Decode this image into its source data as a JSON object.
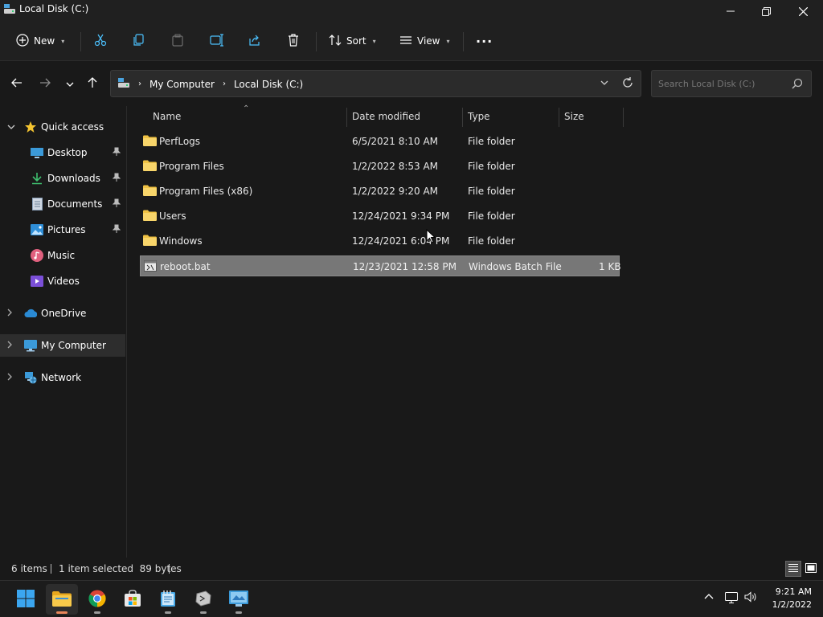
{
  "window": {
    "title": "Local Disk (C:)"
  },
  "toolbar": {
    "new_label": "New",
    "sort_label": "Sort",
    "view_label": "View",
    "more_label": "···"
  },
  "address": {
    "crumbs": [
      "My Computer",
      "Local Disk (C:)"
    ],
    "search_placeholder": "Search Local Disk (C:)"
  },
  "nav": {
    "quick_access": "Quick access",
    "items": [
      {
        "label": "Desktop",
        "icon": "desktop-icon",
        "pinned": true
      },
      {
        "label": "Downloads",
        "icon": "downloads-icon",
        "pinned": true
      },
      {
        "label": "Documents",
        "icon": "documents-icon",
        "pinned": true
      },
      {
        "label": "Pictures",
        "icon": "pictures-icon",
        "pinned": true
      },
      {
        "label": "Music",
        "icon": "music-icon",
        "pinned": false
      },
      {
        "label": "Videos",
        "icon": "videos-icon",
        "pinned": false
      }
    ],
    "onedrive": "OneDrive",
    "my_computer": "My Computer",
    "network": "Network"
  },
  "columns": {
    "name": "Name",
    "date": "Date modified",
    "type": "Type",
    "size": "Size"
  },
  "files": [
    {
      "name": "PerfLogs",
      "date": "6/5/2021 8:10 AM",
      "type": "File folder",
      "size": ""
    },
    {
      "name": "Program Files",
      "date": "1/2/2022 8:53 AM",
      "type": "File folder",
      "size": ""
    },
    {
      "name": "Program Files (x86)",
      "date": "1/2/2022 9:20 AM",
      "type": "File folder",
      "size": ""
    },
    {
      "name": "Users",
      "date": "12/24/2021 9:34 PM",
      "type": "File folder",
      "size": ""
    },
    {
      "name": "Windows",
      "date": "12/24/2021 6:04 PM",
      "type": "File folder",
      "size": ""
    },
    {
      "name": "reboot.bat",
      "date": "12/23/2021 12:58 PM",
      "type": "Windows Batch File",
      "size": "1 KB"
    }
  ],
  "status": {
    "count": "6 items",
    "selection": "1 item selected  89 bytes"
  },
  "clock": {
    "time": "9:21 AM",
    "date": "1/2/2022"
  },
  "colors": {
    "selected_row": "#777777",
    "folder": "#f0c244",
    "accent": "#4cc2ff"
  }
}
